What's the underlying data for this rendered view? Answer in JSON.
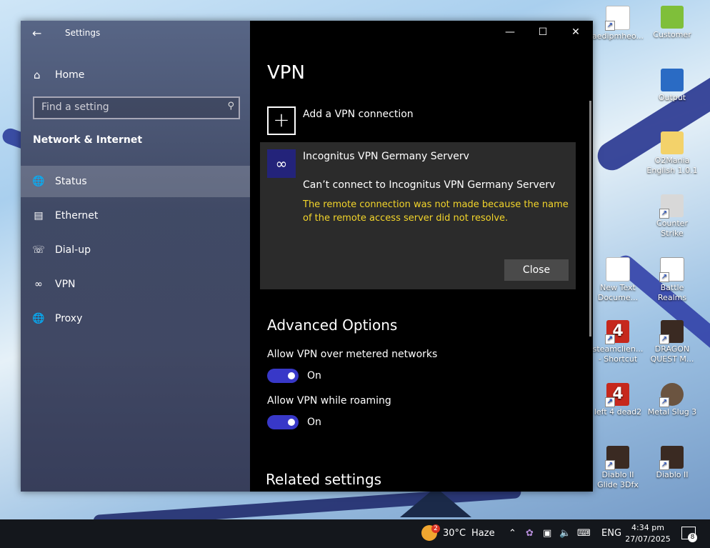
{
  "desktop_icons": [
    {
      "label": "aedipmheo...",
      "icon": "shortcut-doc-icon"
    },
    {
      "label": "Customer",
      "icon": "download-green-icon"
    },
    {
      "label": "Output",
      "icon": "output-icon"
    },
    {
      "label": "O2Mania English 1.0.1",
      "icon": "folder-icon"
    },
    {
      "label": "Counter Strike",
      "icon": "counter-strike-icon"
    },
    {
      "label": "New Text Docume...",
      "icon": "text-document-icon"
    },
    {
      "label": "Battle Realms",
      "icon": "battle-realms-icon"
    },
    {
      "label": "steamclien... - Shortcut",
      "icon": "left4dead-icon"
    },
    {
      "label": "DRAGON QUEST M...",
      "icon": "dragon-quest-icon"
    },
    {
      "label": "left 4 dead2",
      "icon": "left4dead-icon"
    },
    {
      "label": "Metal Slug 3",
      "icon": "metal-slug-icon"
    },
    {
      "label": "Diablo II Glide 3Dfx",
      "icon": "diablo-icon"
    },
    {
      "label": "Diablo II",
      "icon": "diablo-icon"
    }
  ],
  "settings": {
    "title": "Settings",
    "home": "Home",
    "search_placeholder": "Find a setting",
    "section": "Network & Internet",
    "nav": [
      {
        "label": "Status",
        "icon": "globe-icon",
        "active": true
      },
      {
        "label": "Ethernet",
        "icon": "ethernet-icon",
        "active": false
      },
      {
        "label": "Dial-up",
        "icon": "dialup-icon",
        "active": false
      },
      {
        "label": "VPN",
        "icon": "vpn-icon",
        "active": false
      },
      {
        "label": "Proxy",
        "icon": "globe-icon",
        "active": false
      }
    ],
    "page_title": "VPN",
    "add_vpn": "Add a VPN connection",
    "connection": {
      "name": "Incognitus VPN Germany Serverv",
      "status": "Can’t connect to Incognitus VPN Germany Serverv",
      "error": "The remote connection was not made because the name of the remote access server did not resolve.",
      "close": "Close"
    },
    "advanced_title": "Advanced Options",
    "options": [
      {
        "label": "Allow VPN over metered networks",
        "state": "On"
      },
      {
        "label": "Allow VPN while roaming",
        "state": "On"
      }
    ],
    "related": "Related settings"
  },
  "taskbar": {
    "weather_badge": "2",
    "temperature": "30°C",
    "condition": "Haze",
    "language": "ENG",
    "time": "4:34 pm",
    "date": "27/07/2025",
    "notifications": "8"
  },
  "colors": {
    "accent": "#3838c8",
    "error": "#f3d52b",
    "card": "#2b2b2b"
  }
}
